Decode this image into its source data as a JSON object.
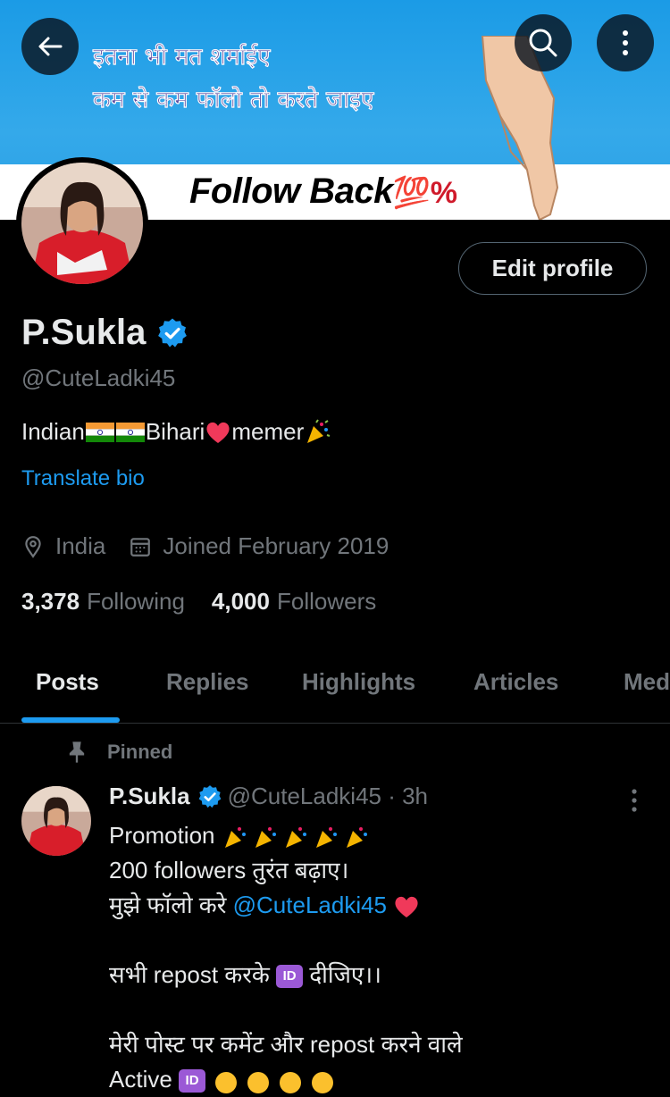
{
  "banner": {
    "line1": "इतना भी मत शर्माईए",
    "line2": "कम से कम फॉलो तो करते जाइए",
    "follow_text": "Follow Back",
    "hundred": "💯%"
  },
  "profile": {
    "name": "P.Sukla",
    "handle": "@CuteLadki45",
    "bio_prefix": "Indian",
    "bio_mid": " Bihari",
    "bio_suffix": " memer",
    "translate": "Translate bio",
    "location": "India",
    "joined": "Joined February 2019",
    "following_count": "3,378",
    "following_label": "Following",
    "followers_count": "4,000",
    "followers_label": "Followers",
    "edit_button": "Edit profile"
  },
  "tabs": [
    {
      "label": "Posts"
    },
    {
      "label": "Replies"
    },
    {
      "label": "Highlights"
    },
    {
      "label": "Articles"
    },
    {
      "label": "Media"
    }
  ],
  "post": {
    "pinned_label": "Pinned",
    "name": "P.Sukla",
    "handle_time": "@CuteLadki45 · 3h",
    "line1": "Promotion ",
    "line2": "200 followers तुरंत बढ़ाए।",
    "line3_prefix": " मुझे फॉलो करे ",
    "line3_mention": "@CuteLadki45",
    "line5_prefix": "सभी repost करके ",
    "line5_suffix": " दीजिए।।",
    "line7": "मेरी पोस्ट पर कमेंट और repost करने वाले",
    "line8_prefix": "Active ",
    "id_badge": "ID"
  },
  "colors": {
    "accent": "#1d9bf0",
    "muted": "#71767b",
    "text": "#e7e9ea",
    "background": "#000000"
  }
}
